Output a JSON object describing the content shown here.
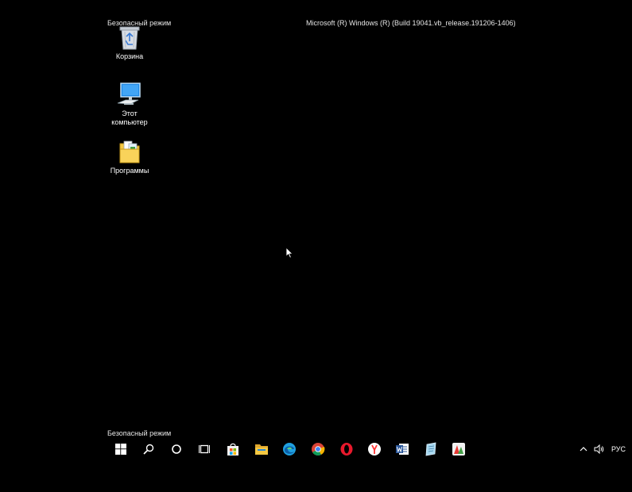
{
  "watermark": {
    "safe_mode_top": "Безопасный режим",
    "safe_mode_bottom": "Безопасный режим",
    "build": "Microsoft (R) Windows (R) (Build 19041.vb_release.191206-1406)"
  },
  "desktop": {
    "icons": [
      {
        "label": "Корзина",
        "icon": "recycle-bin-icon"
      },
      {
        "label": "Этот\nкомпьютер",
        "icon": "this-pc-icon"
      },
      {
        "label": "Программы",
        "icon": "folder-icon"
      }
    ]
  },
  "taskbar": {
    "items": [
      {
        "name": "start",
        "icon": "windows-logo-icon"
      },
      {
        "name": "search",
        "icon": "search-icon"
      },
      {
        "name": "cortana",
        "icon": "cortana-icon"
      },
      {
        "name": "task-view",
        "icon": "task-view-icon"
      },
      {
        "name": "store",
        "icon": "store-icon"
      },
      {
        "name": "file-explorer",
        "icon": "folder-icon"
      },
      {
        "name": "edge",
        "icon": "edge-icon"
      },
      {
        "name": "chrome",
        "icon": "chrome-icon"
      },
      {
        "name": "opera",
        "icon": "opera-icon"
      },
      {
        "name": "yandex-browser",
        "icon": "yandex-icon"
      },
      {
        "name": "word",
        "icon": "word-icon"
      },
      {
        "name": "notepad",
        "icon": "notepad-icon"
      },
      {
        "name": "app",
        "icon": "app-icon"
      }
    ],
    "tray": {
      "language": "РУС"
    }
  },
  "colors": {
    "background": "#000000",
    "edge": "#1fa0e0",
    "opera": "#e8192c",
    "yandex": "#ff3333",
    "word": "#2b579a",
    "folder": "#f5c842"
  }
}
